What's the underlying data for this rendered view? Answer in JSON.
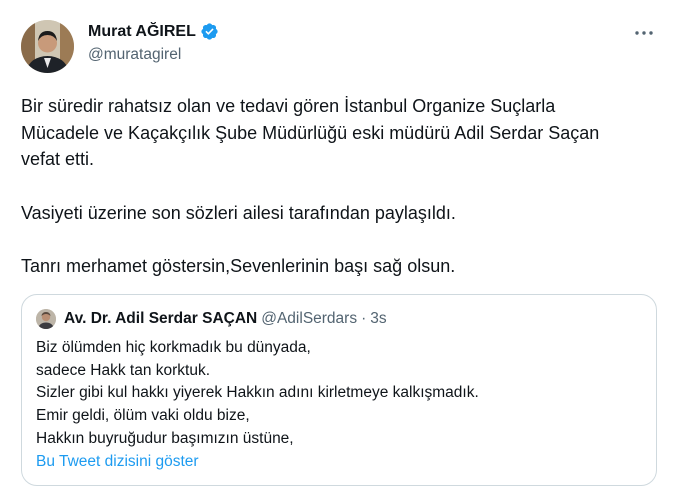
{
  "author": {
    "name": "Murat AĞIREL",
    "handle": "@muratagirel",
    "verified_color": "#1d9bf0"
  },
  "tweet": {
    "paragraphs": [
      "Bir süredir rahatsız olan ve tedavi gören İstanbul Organize Suçlarla",
      "Mücadele ve Kaçakçılık Şube Müdürlüğü eski müdürü Adil Serdar Saçan",
      "vefat etti.",
      "Vasiyeti üzerine son sözleri ailesi tarafından paylaşıldı.",
      "Tanrı merhamet göstersin,Sevenlerinin başı sağ olsun."
    ]
  },
  "quote": {
    "name": "Av. Dr. Adil Serdar SAÇAN",
    "handle": "@AdilSerdars",
    "separator": "·",
    "time": "3s",
    "lines": [
      "Biz ölümden hiç korkmadık bu dünyada,",
      "sadece Hakk tan korktuk.",
      "Sizler gibi kul hakkı yiyerek Hakkın adını kirletmeye kalkışmadık.",
      "Emir geldi, ölüm vaki oldu bize,",
      "Hakkın buyruğudur başımızın üstüne,"
    ],
    "show_thread_label": "Bu Tweet dizisini göster"
  },
  "colors": {
    "text": "#0f1419",
    "secondary": "#536471",
    "link": "#1d9bf0",
    "border": "#cfd9de"
  },
  "icons": {
    "verified": "verified-badge-icon",
    "more": "more-horizontal-icon"
  }
}
